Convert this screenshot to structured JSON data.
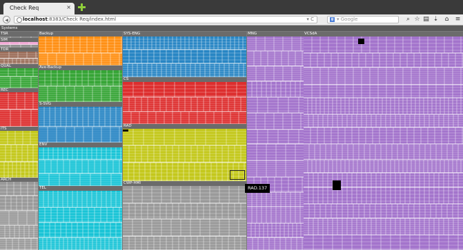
{
  "window": {
    "tab_title": "Check Req",
    "close_glyph": "×"
  },
  "navbar": {
    "url_host": "localhost",
    "url_rest": ":8383/Check Req/index.html",
    "reload_glyph": "▾ C",
    "search_engine_badge": "g",
    "search_placeholder": "▾ Google",
    "icons": [
      "search-icon",
      "star-icon",
      "clipboard-icon",
      "download-icon",
      "home-icon",
      "menu-icon"
    ]
  },
  "treemap": {
    "root_label": "Systems",
    "groups": [
      {
        "key": "tsr",
        "label": "TSR",
        "color": "#8a8a8a"
      },
      {
        "key": "sim",
        "label": "SIM",
        "color": "#f2a9d6"
      },
      {
        "key": "tdr",
        "label": "TDR",
        "color": "#9b6c58"
      },
      {
        "key": "qual",
        "label": "QUAL",
        "color": "#36a536"
      },
      {
        "key": "rec",
        "label": "REC",
        "color": "#dd2e2e"
      },
      {
        "key": "its",
        "label": "ITS",
        "color": "#c4c81c"
      },
      {
        "key": "arch",
        "label": "ARCH",
        "color": "#9a9a9a"
      },
      {
        "key": "backup",
        "label": "Backup",
        "color": "#ff8f13"
      },
      {
        "key": "ave_backup",
        "label": "Ave-Backup",
        "color": "#36a536"
      },
      {
        "key": "s_svg",
        "label": "S-SVG",
        "color": "#2886c4"
      },
      {
        "key": "env",
        "label": "ENV",
        "color": "#18c4d6"
      },
      {
        "key": "tel",
        "label": "TEL",
        "color": "#18c4d6"
      },
      {
        "key": "sys_eng",
        "label": "SYS-ENG",
        "color": "#2886c4"
      },
      {
        "key": "cs",
        "label": "CS",
        "color": "#dd2e2e"
      },
      {
        "key": "rad",
        "label": "RAD",
        "color": "#c4c81c"
      },
      {
        "key": "cwp_hmi",
        "label": "CWP-HMI",
        "color": "#9a9a9a"
      },
      {
        "key": "mng",
        "label": "MNG",
        "color": "#a374cc"
      },
      {
        "key": "vcsaa",
        "label": "VCSdA",
        "color": "#a374cc"
      }
    ],
    "tooltip": "RAD.137"
  }
}
